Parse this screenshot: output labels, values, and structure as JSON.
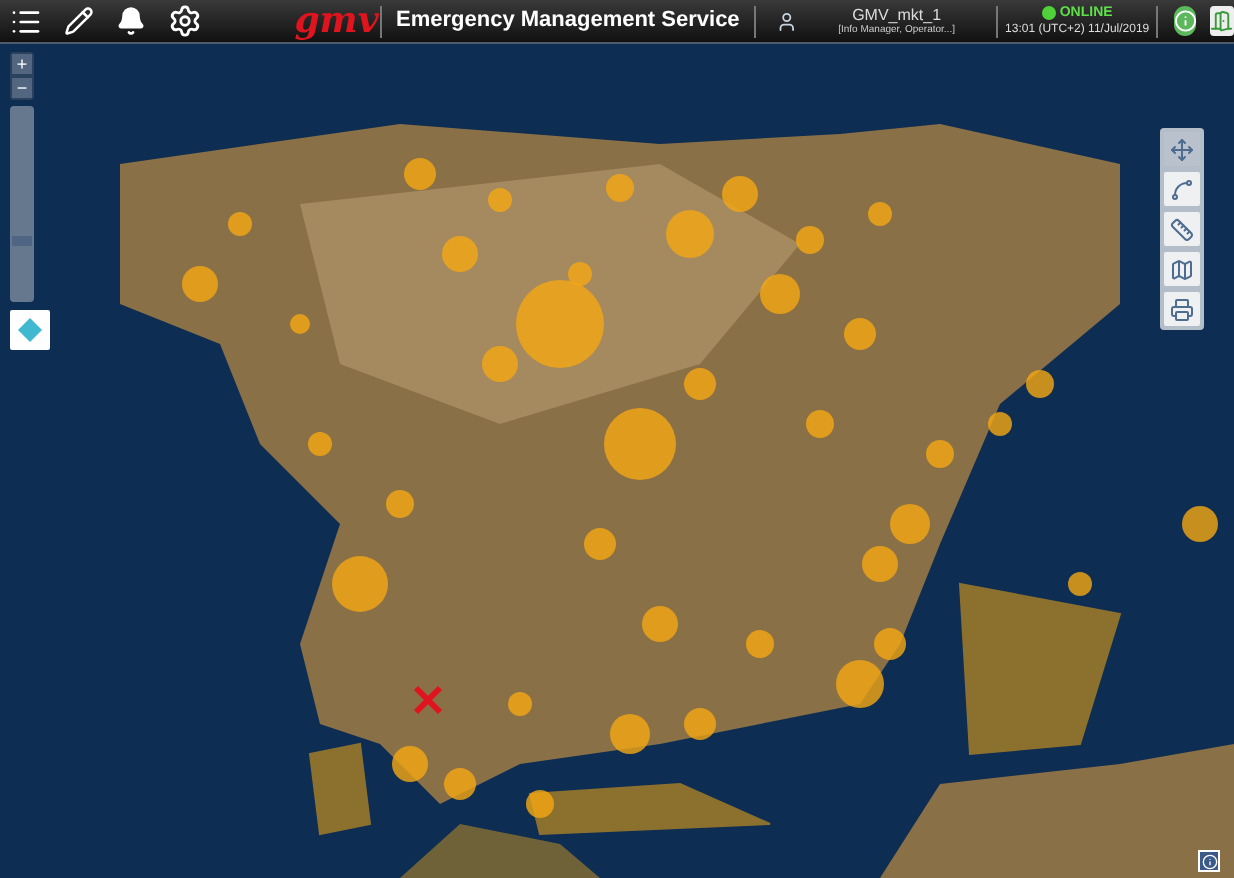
{
  "header": {
    "logo": "gmv",
    "title": "Emergency Management Service",
    "user": {
      "name": "GMV_mkt_1",
      "roles": "[Info Manager, Operator...]"
    },
    "status": {
      "label": "ONLINE",
      "online": true,
      "datetime": "13:01 (UTC+2) 11/Jul/2019"
    }
  },
  "zoom": {
    "plus": "+",
    "minus": "−",
    "level": 0.3
  },
  "map_tools": [
    {
      "kind": "pan",
      "selected": true
    },
    {
      "kind": "route",
      "selected": false
    },
    {
      "kind": "measure",
      "selected": false
    },
    {
      "kind": "layers",
      "selected": false
    },
    {
      "kind": "print",
      "selected": false
    }
  ]
}
